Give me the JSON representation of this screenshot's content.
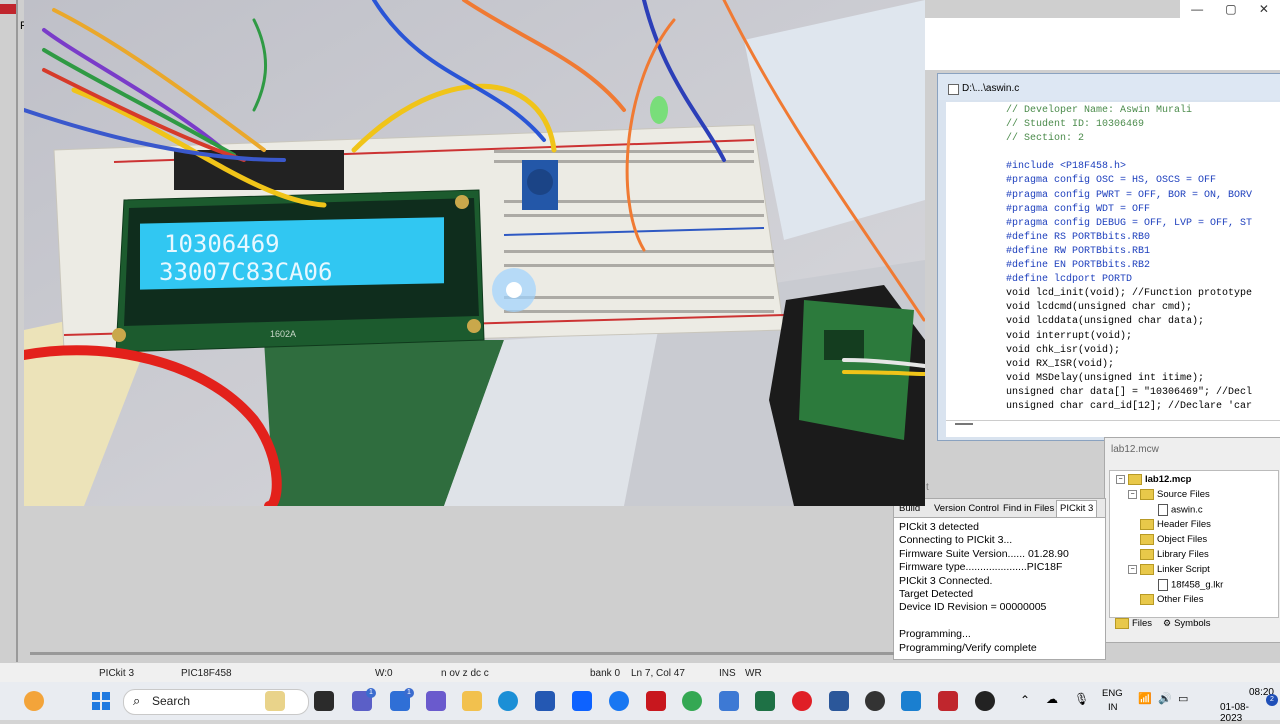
{
  "window": {
    "editor_title": "D:\\...\\aswin.c",
    "project_title": "lab12.mcw",
    "menu_letter": "F",
    "controls": [
      "—",
      "▢",
      "✕"
    ]
  },
  "editor": {
    "lines": [
      "// Developer Name: Aswin Murali",
      "// Student ID: 10306469",
      "// Section: 2",
      "",
      "#include <P18F458.h>",
      "#pragma config OSC = HS, OSCS = OFF",
      "#pragma config PWRT = OFF, BOR = ON, BORV",
      "#pragma config WDT = OFF",
      "#pragma config DEBUG = OFF, LVP = OFF, ST",
      "#define RS PORTBbits.RB0",
      "#define RW PORTBbits.RB1",
      "#define EN PORTBbits.RB2",
      "#define lcdport PORTD",
      "void lcd_init(void); //Function prototype",
      "void lcdcmd(unsigned char cmd);",
      "void lcddata(unsigned char data);",
      "void interrupt(void);",
      "void chk_isr(void);",
      "void RX_ISR(void);",
      "void MSDelay(unsigned int itime);",
      "unsigned char data[] = \"10306469\"; //Decl",
      "unsigned char card_id[12]; //Declare 'car"
    ]
  },
  "project": {
    "root": "lab12.mcp",
    "items": [
      {
        "label": "Source Files",
        "type": "folder",
        "level": 1,
        "expander": "−"
      },
      {
        "label": "aswin.c",
        "type": "file",
        "level": 2,
        "expander": ""
      },
      {
        "label": "Header Files",
        "type": "folder",
        "level": 1,
        "expander": ""
      },
      {
        "label": "Object Files",
        "type": "folder",
        "level": 1,
        "expander": ""
      },
      {
        "label": "Library Files",
        "type": "folder",
        "level": 1,
        "expander": ""
      },
      {
        "label": "Linker Script",
        "type": "folder",
        "level": 1,
        "expander": "−"
      },
      {
        "label": "18f458_g.lkr",
        "type": "file",
        "level": 2,
        "expander": ""
      },
      {
        "label": "Other Files",
        "type": "folder",
        "level": 1,
        "expander": ""
      }
    ],
    "tabs": [
      "Files",
      "Symbols"
    ]
  },
  "output": {
    "label_fragment": "t",
    "tabs": [
      "Build",
      "Version Control",
      "Find in Files",
      "PICkit 3"
    ],
    "lines": [
      "PICkit 3 detected",
      "Connecting to PICkit 3...",
      "Firmware Suite Version...... 01.28.90",
      "Firmware type.....................PIC18F",
      "PICkit 3 Connected.",
      "Target Detected",
      "Device ID Revision = 00000005",
      "",
      "Programming...",
      "Programming/Verify complete"
    ]
  },
  "photo": {
    "lcd_line1": "10306469",
    "lcd_line2": "33007C83CA06",
    "lcd_model": "1602A"
  },
  "statusbar": {
    "programmer": "PICkit 3",
    "device": "PIC18F458",
    "w": "W:0",
    "flags": "n ov z dc c",
    "bank": "bank 0",
    "position": "Ln 7, Col 47",
    "ins": "INS",
    "wr": "WR"
  },
  "taskbar": {
    "search": "Search",
    "badge_1": "1",
    "badge_2": "1",
    "lang1": "ENG",
    "lang2": "IN",
    "time": "08:20",
    "date": "01-08-2023",
    "notifications": "2"
  },
  "colors": {
    "lcd_bg": "#31c7f2",
    "lcd_text": "#e8f8ff",
    "pcb_green": "#2c7a3c",
    "breadboard": "#ece9e1"
  }
}
